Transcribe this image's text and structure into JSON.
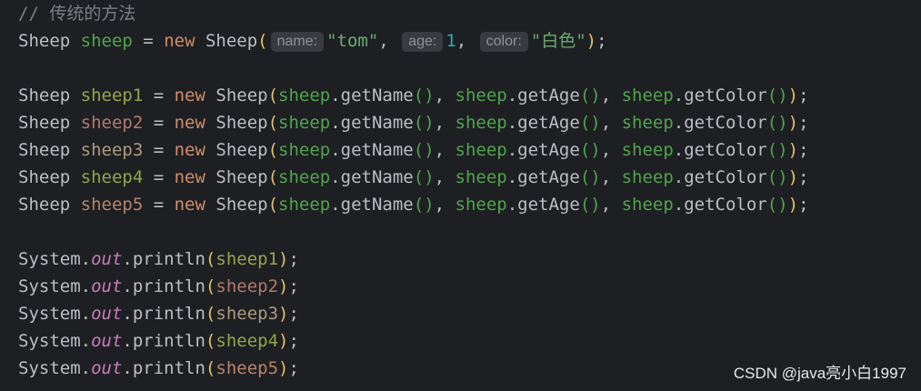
{
  "comment": "// 传统的方法",
  "line_new_sheep": {
    "type": "Sheep",
    "var": "sheep",
    "op": " = ",
    "kw": "new",
    "ctor": " Sheep",
    "hint_name": "name:",
    "arg_name": "\"tom\"",
    "hint_age": "age:",
    "arg_age": "1",
    "hint_color": "color:",
    "arg_color": "\"白色\"",
    "end": ");"
  },
  "clone_lines": [
    {
      "var": "sheep1"
    },
    {
      "var": "sheep2"
    },
    {
      "var": "sheep3"
    },
    {
      "var": "sheep4"
    },
    {
      "var": "sheep5"
    }
  ],
  "clone_parts": {
    "type": "Sheep ",
    "op": " = ",
    "kw": "new",
    "ctor": " Sheep",
    "ref": "sheep",
    "get_name": ".getName",
    "get_age": ".getAge",
    "get_color": ".getColor",
    "end": ";"
  },
  "print_parts": {
    "system": "System.",
    "out": "out",
    "println": ".println",
    "end": ";"
  },
  "print_lines": [
    {
      "var": "sheep1"
    },
    {
      "var": "sheep2"
    },
    {
      "var": "sheep3"
    },
    {
      "var": "sheep4"
    },
    {
      "var": "sheep5"
    }
  ],
  "watermark": "CSDN @java亮小白1997"
}
